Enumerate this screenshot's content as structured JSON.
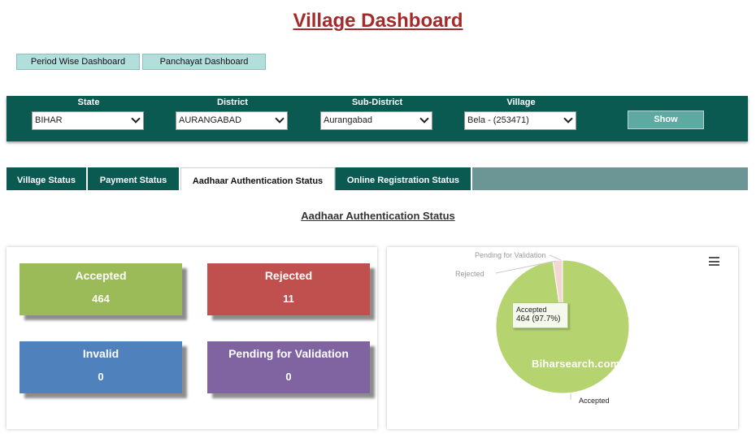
{
  "page": {
    "title": "Village Dashboard"
  },
  "top_buttons": [
    "Period Wise Dashboard",
    "Panchayat Dashboard"
  ],
  "filters": {
    "state": {
      "label": "State",
      "value": "BIHAR"
    },
    "district": {
      "label": "District",
      "value": "AURANGABAD"
    },
    "sub_district": {
      "label": "Sub-District",
      "value": "Aurangabad"
    },
    "village": {
      "label": "Village",
      "value": "Bela - (253471)"
    },
    "show_label": "Show"
  },
  "tabs": [
    {
      "label": "Village Status",
      "active": false
    },
    {
      "label": "Payment Status",
      "active": false
    },
    {
      "label": "Aadhaar Authentication Status",
      "active": true
    },
    {
      "label": "Online Registration Status",
      "active": false
    }
  ],
  "section_title": "Aadhaar Authentication Status",
  "cards": [
    {
      "label": "Accepted",
      "value": "464",
      "color": "#9bbb59"
    },
    {
      "label": "Rejected",
      "value": "11",
      "color": "#c0504d"
    },
    {
      "label": "Invalid",
      "value": "0",
      "color": "#4f81bd"
    },
    {
      "label": "Pending for Validation",
      "value": "0",
      "color": "#8064a2"
    }
  ],
  "chart_data": {
    "type": "pie",
    "slices": [
      {
        "name": "Accepted",
        "value": 464,
        "color": "#b5d36f"
      },
      {
        "name": "Rejected",
        "value": 11,
        "color": "#f2d7d5"
      },
      {
        "name": "Pending for Validation",
        "value": 0,
        "color": "#e6d3f0"
      }
    ],
    "tooltip": {
      "label": "Accepted",
      "value": "464 (97.7%)"
    },
    "watermark": "Biharsearch.com"
  },
  "icons": {
    "menu": "hamburger-menu-icon",
    "dropdown": "chevron-down-icon"
  }
}
